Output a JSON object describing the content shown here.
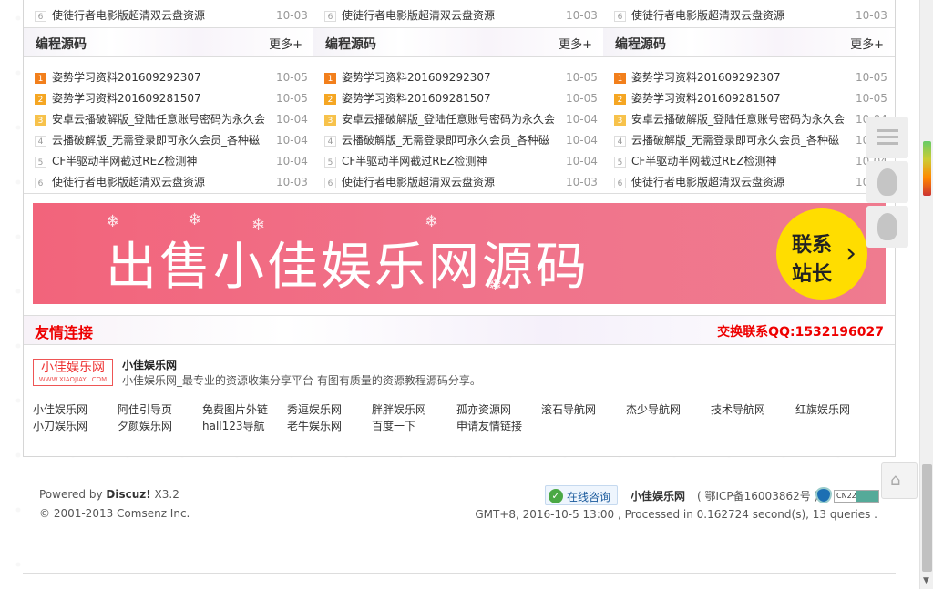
{
  "top_row": [
    {
      "rank": "6",
      "title": "使徒行者电影版超清双云盘资源",
      "date": "10-03"
    },
    {
      "rank": "6",
      "title": "使徒行者电影版超清双云盘资源",
      "date": "10-03"
    },
    {
      "rank": "6",
      "title": "使徒行者电影版超清双云盘资源",
      "date": "10-03"
    }
  ],
  "columns": [
    {
      "header": "编程源码",
      "more": "更多+",
      "items": [
        {
          "rank": "1",
          "title": "姿势学习资料201609292307",
          "date": "10-05"
        },
        {
          "rank": "2",
          "title": "姿势学习资料201609281507",
          "date": "10-05"
        },
        {
          "rank": "3",
          "title": "安卓云播破解版_登陆任意账号密码为永久会",
          "date": "10-04"
        },
        {
          "rank": "4",
          "title": "云播破解版_无需登录即可永久会员_各种磁",
          "date": "10-04"
        },
        {
          "rank": "5",
          "title": "CF半驱动半网截过REZ检测神",
          "date": "10-04"
        },
        {
          "rank": "6",
          "title": "使徒行者电影版超清双云盘资源",
          "date": "10-03"
        }
      ]
    },
    {
      "header": "编程源码",
      "more": "更多+",
      "items": [
        {
          "rank": "1",
          "title": "姿势学习资料201609292307",
          "date": "10-05"
        },
        {
          "rank": "2",
          "title": "姿势学习资料201609281507",
          "date": "10-05"
        },
        {
          "rank": "3",
          "title": "安卓云播破解版_登陆任意账号密码为永久会",
          "date": "10-04"
        },
        {
          "rank": "4",
          "title": "云播破解版_无需登录即可永久会员_各种磁",
          "date": "10-04"
        },
        {
          "rank": "5",
          "title": "CF半驱动半网截过REZ检测神",
          "date": "10-04"
        },
        {
          "rank": "6",
          "title": "使徒行者电影版超清双云盘资源",
          "date": "10-03"
        }
      ]
    },
    {
      "header": "编程源码",
      "more": "更多+",
      "items": [
        {
          "rank": "1",
          "title": "姿势学习资料201609292307",
          "date": "10-05"
        },
        {
          "rank": "2",
          "title": "姿势学习资料201609281507",
          "date": "10-05"
        },
        {
          "rank": "3",
          "title": "安卓云播破解版_登陆任意账号密码为永久会",
          "date": "10-04"
        },
        {
          "rank": "4",
          "title": "云播破解版_无需登录即可永久会员_各种磁",
          "date": "10-04"
        },
        {
          "rank": "5",
          "title": "CF半驱动半网截过REZ检测神",
          "date": "10-04"
        },
        {
          "rank": "6",
          "title": "使徒行者电影版超清双云盘资源",
          "date": "10-03"
        }
      ]
    }
  ],
  "banner": {
    "text": "出售小佳娱乐网源码",
    "contact_line1": "联系",
    "contact_line2": "站长"
  },
  "friend_links": {
    "title": "友情连接",
    "contact": "交换联系QQ:1532196027",
    "logo_text": "小佳娱乐网",
    "logo_sub": "WWW.XIAOJIAYL.COM",
    "site_name": "小佳娱乐网",
    "site_desc": "小佳娱乐网_最专业的资源收集分享平台 有图有质量的资源教程源码分享。",
    "links": [
      "小佳娱乐网",
      "阿佳引导页",
      "免费图片外链",
      "秀逗娱乐网",
      "胖胖娱乐网",
      "孤亦资源网",
      "滚石导航网",
      "杰少导航网",
      "技术导航网",
      "红旗娱乐网",
      "小刀娱乐网",
      "夕颜娱乐网",
      "hall123导航",
      "老牛娱乐网",
      "百度一下",
      "申请友情链接"
    ]
  },
  "footer": {
    "powered_prefix": "Powered by ",
    "powered_brand": "Discuz!",
    "powered_version": " X3.2",
    "copyright": "© 2001-2013 Comsenz Inc.",
    "consult": "在线咨询",
    "site": "小佳娱乐网",
    "icp": "( 鄂ICP备16003862号 )",
    "badge": "CN22",
    "stats": "GMT+8, 2016-10-5 13:00 , Processed in 0.162724 second(s), 13 queries ."
  },
  "colors": {
    "accent_red": "#ee0000",
    "rank1": "#f27f1b",
    "rank2": "#f5a623",
    "rank3": "#f7c24b",
    "banner_bg": "#f0728a",
    "contact_bg": "#ffdd00"
  }
}
